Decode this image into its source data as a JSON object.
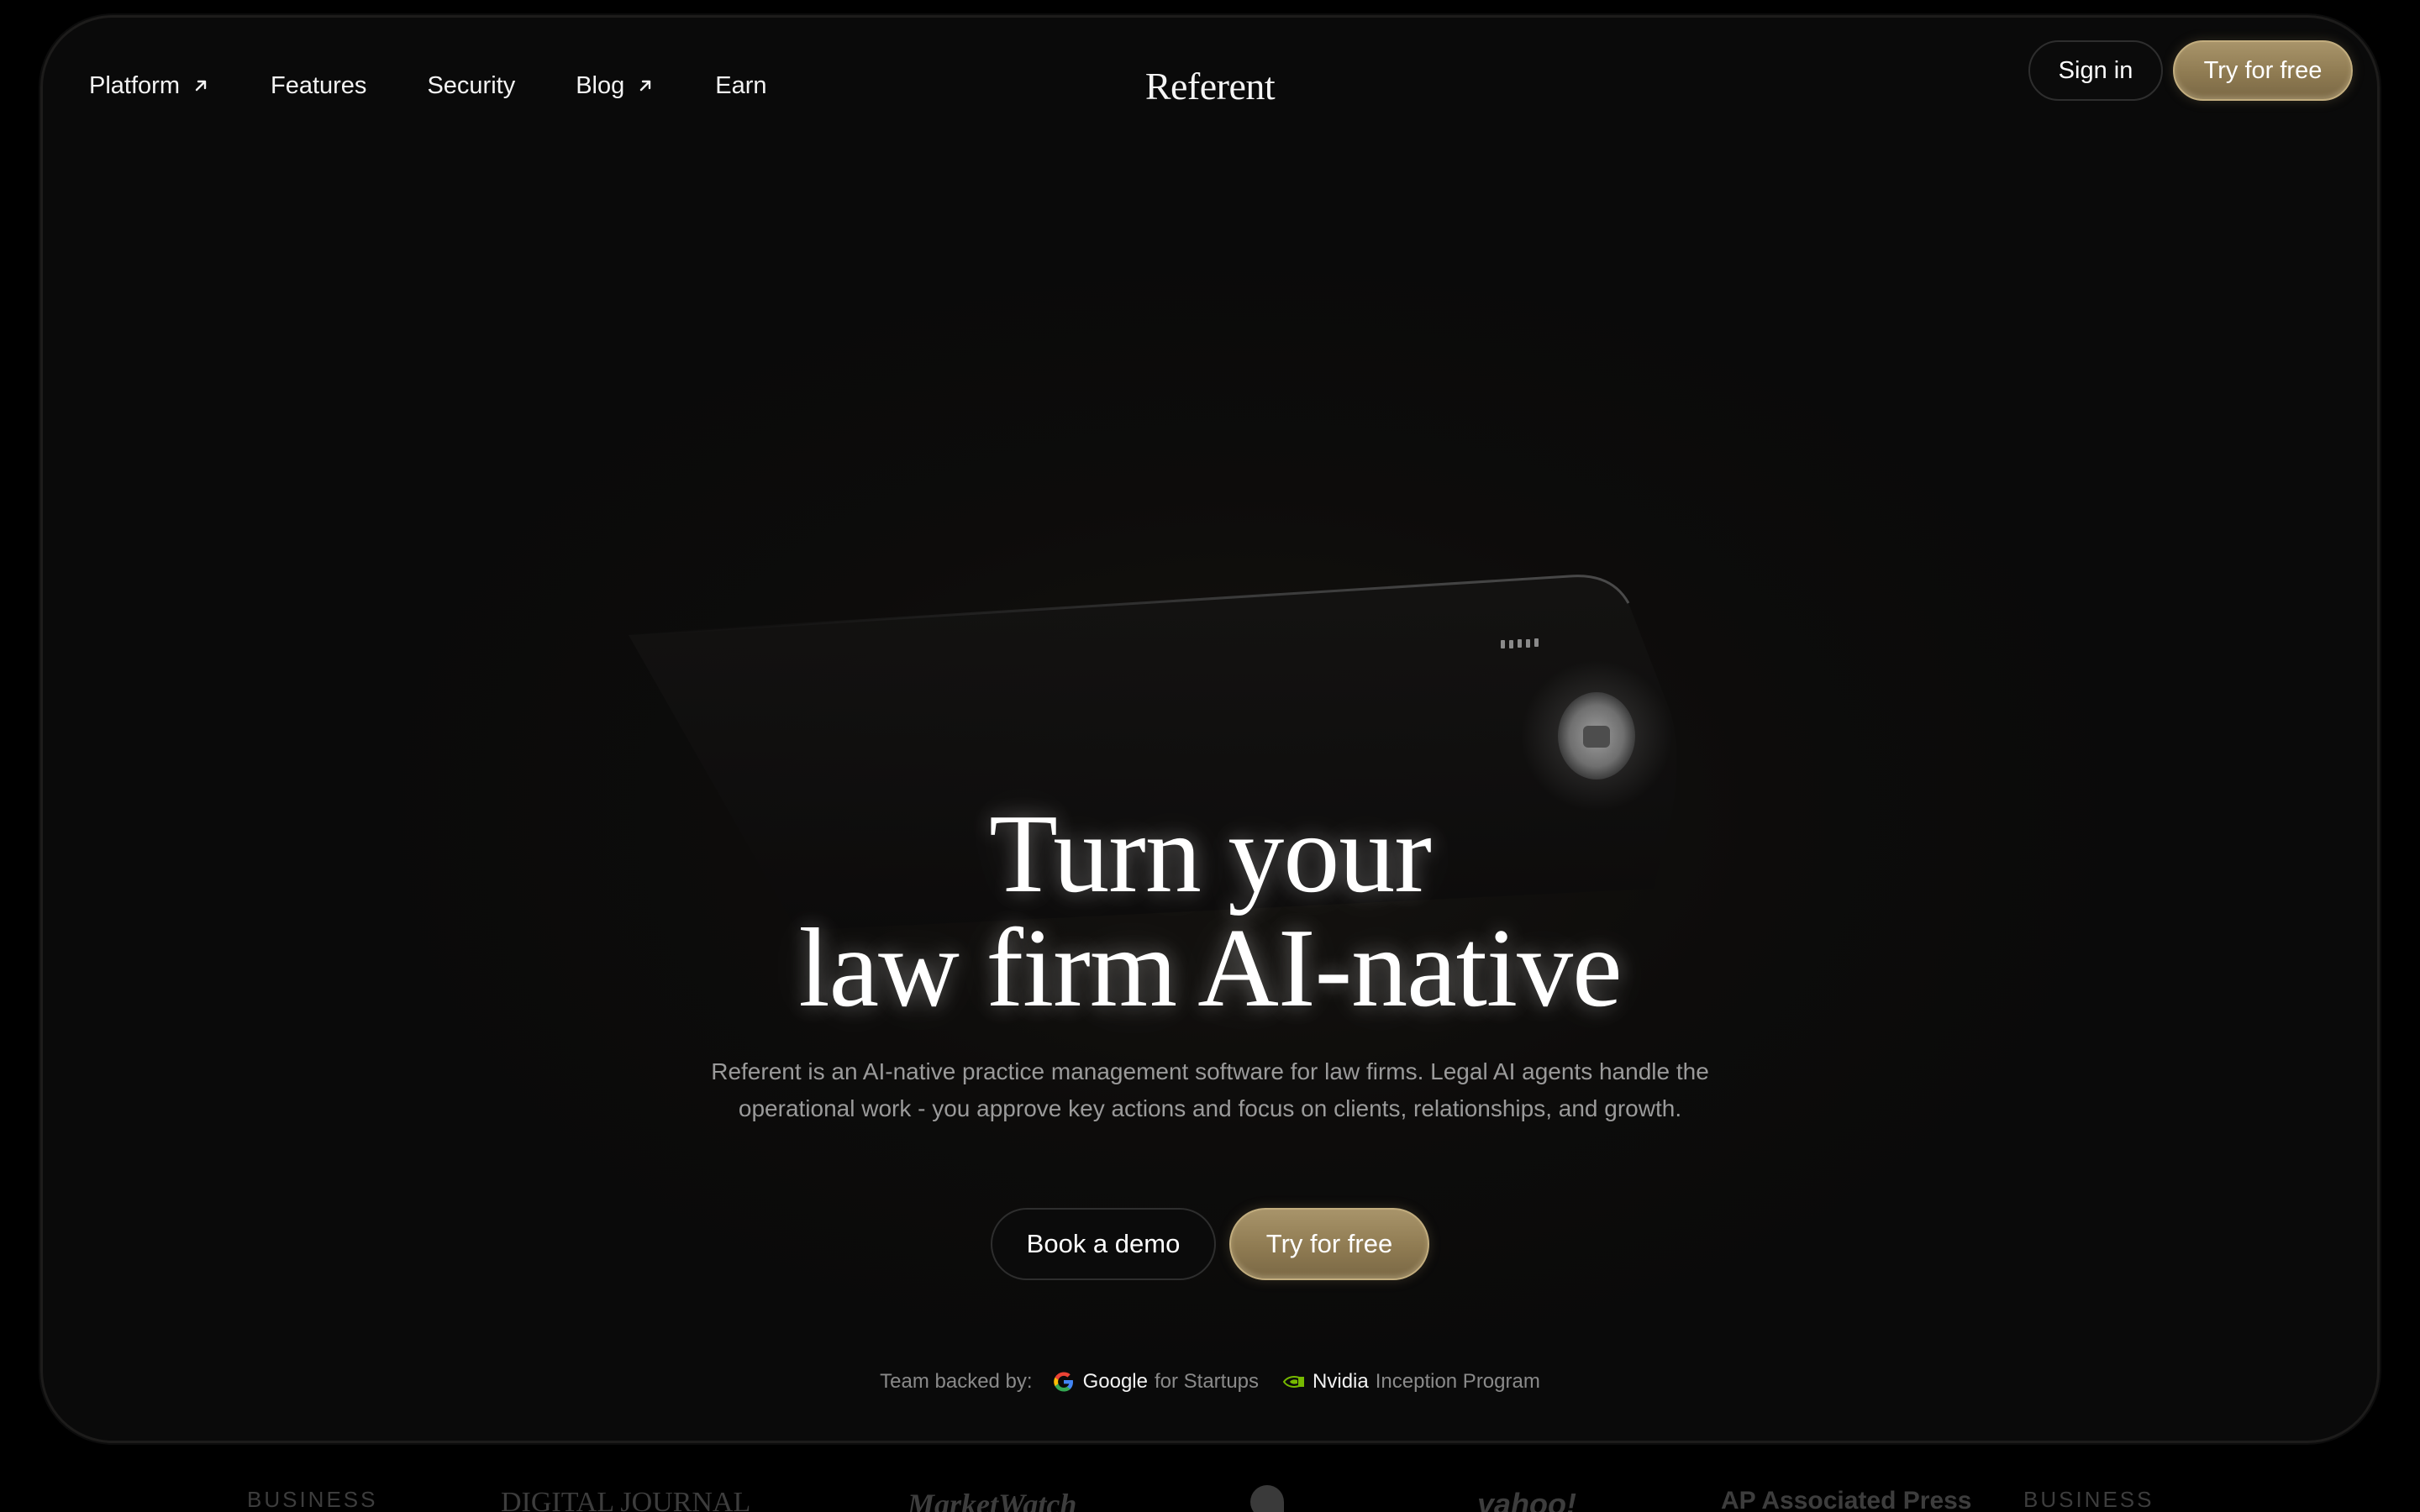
{
  "nav": {
    "items": [
      {
        "label": "Platform",
        "external": true
      },
      {
        "label": "Features",
        "external": false
      },
      {
        "label": "Security",
        "external": false
      },
      {
        "label": "Blog",
        "external": true
      },
      {
        "label": "Earn",
        "external": false
      }
    ],
    "logo": "Referent",
    "sign_in": "Sign in",
    "try_free": "Try for free"
  },
  "hero": {
    "title_line1": "Turn your",
    "title_line2": "law firm AI-native",
    "subtitle_line1": "Referent is an AI-native practice management software for law firms. Legal AI agents handle the",
    "subtitle_line2": "operational work - you approve key actions and focus on clients, relationships, and growth.",
    "book_demo": "Book a demo",
    "try_free": "Try for free"
  },
  "backed": {
    "label": "Team backed by:",
    "google_brand": "Google",
    "google_suffix": "for Startups",
    "nvidia_brand": "Nvidia",
    "nvidia_suffix": "Inception Program"
  },
  "press": {
    "items": [
      "BUSINESS",
      "DIGITAL JOURNAL",
      "MarketWatch",
      "yahoo!",
      "AP Associated Press",
      "BUSINESS"
    ]
  },
  "colors": {
    "background": "#000000",
    "frame": "#0d0c0b",
    "gold_accent": "#9a8660",
    "subtitle_text": "#9a9a9a"
  },
  "icons": {
    "external_link": "arrow-up-right-icon",
    "google": "google-icon",
    "nvidia": "nvidia-icon"
  }
}
